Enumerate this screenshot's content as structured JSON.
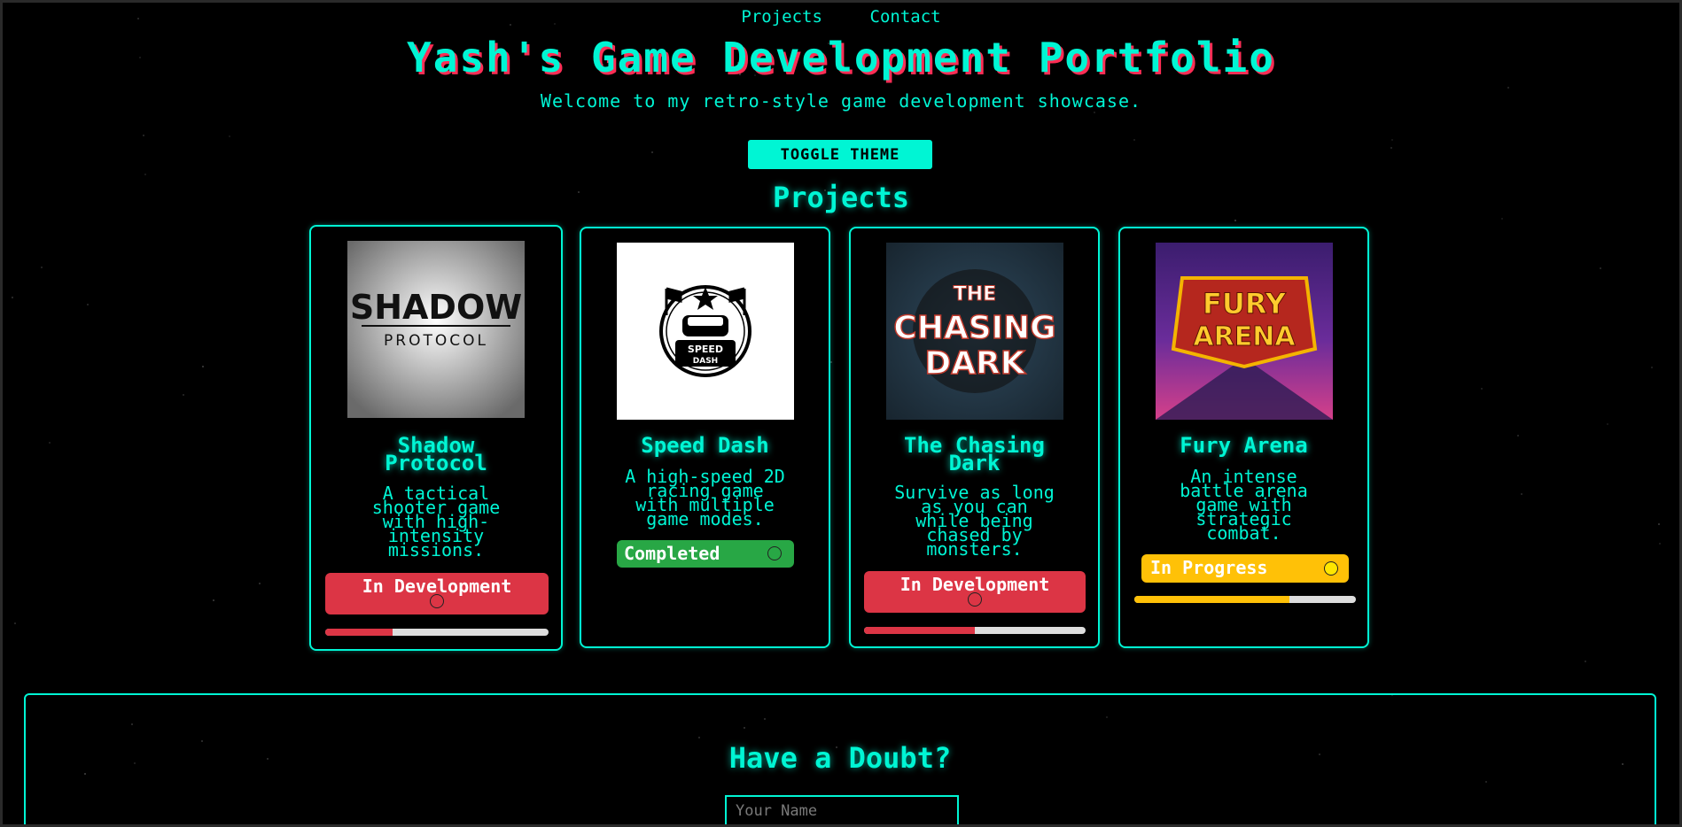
{
  "nav": {
    "projects": "Projects",
    "contact": "Contact"
  },
  "header": {
    "title": "Yash's Game Development Portfolio",
    "subtitle": "Welcome to my retro-style game development showcase."
  },
  "toggle_label": "TOGGLE THEME",
  "projects_heading": "Projects",
  "projects": [
    {
      "title_lines": [
        "Shadow",
        "Protocol"
      ],
      "image_text": [
        "SHADOW",
        "PROTOCOL"
      ],
      "desc_lines": [
        "A tactical",
        "shooter game",
        "with high-",
        "intensity",
        "missions."
      ],
      "status": "In Development",
      "status_color": "#dc3545",
      "dot_color": "#dc3545",
      "progress": 0.3
    },
    {
      "title_lines": [
        "Speed Dash"
      ],
      "image_text": [
        "SPEED",
        "DASH"
      ],
      "desc_lines": [
        "A high-speed 2D",
        "racing game",
        "with multiple",
        "game modes."
      ],
      "status": "Completed",
      "status_color": "#28a745",
      "dot_color": "#28a745",
      "progress": null
    },
    {
      "title_lines": [
        "The Chasing",
        "Dark"
      ],
      "image_text": [
        "THE",
        "CHASING",
        "DARK"
      ],
      "desc_lines": [
        "Survive as long",
        "as you can",
        "while being",
        "chased by",
        "monsters."
      ],
      "status": "In Development",
      "status_color": "#dc3545",
      "dot_color": "#dc3545",
      "progress": 0.5
    },
    {
      "title_lines": [
        "Fury Arena"
      ],
      "image_text": [
        "FURY",
        "ARENA"
      ],
      "desc_lines": [
        "An intense",
        "battle arena",
        "game with",
        "strategic",
        "combat."
      ],
      "status": "In Progress",
      "status_color": "#ffc107",
      "dot_color": "#ffe600",
      "progress": 0.7
    }
  ],
  "contact": {
    "heading": "Have a Doubt?",
    "name_placeholder": "Your Name"
  },
  "colors": {
    "accent": "#00f5d4",
    "title_shadow": "#ff2d55",
    "background": "#000000"
  }
}
